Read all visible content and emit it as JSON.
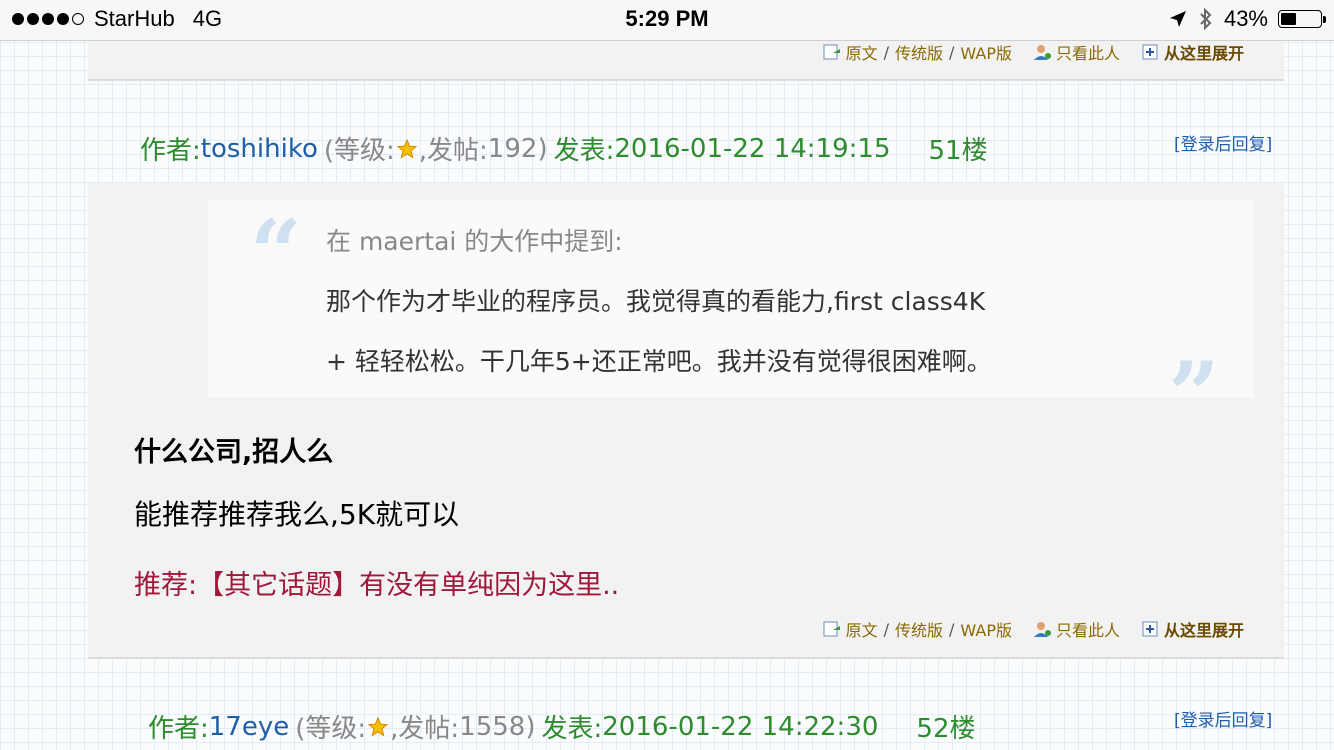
{
  "status_bar": {
    "carrier": "StarHub",
    "network": "4G",
    "time": "5:29 PM",
    "battery_percent": "43%",
    "battery_level": 0.43,
    "icons": [
      "location-arrow-icon",
      "bluetooth-icon",
      "battery-icon"
    ]
  },
  "actions": {
    "original": "原文",
    "separator": "/",
    "classic": "传统版",
    "wap": "WAP版",
    "only_author": "只看此人",
    "expand": "从这里展开"
  },
  "post51": {
    "author_label": "作者:",
    "username": "toshihiko",
    "level_open": "(等级:",
    "posts_label": ",发帖:",
    "posts_count": "192",
    "posts_close": ")",
    "published_label": "发表:",
    "timestamp": "2016-01-22 14:19:15",
    "floor": "51楼",
    "reply_link": "[登录后回复]",
    "quote": {
      "header": "在 maertai 的大作中提到:",
      "line1": "那个作为才毕业的程序员。我觉得真的看能力,first class4K",
      "line2": "+ 轻轻松松。干几年5+还正常吧。我并没有觉得很困难啊。"
    },
    "body_title": "什么公司,招人么",
    "body_text": "能推荐推荐我么,5K就可以",
    "recommend": "推荐:【其它话题】有没有单纯因为这里.."
  },
  "post52": {
    "author_label": "作者:",
    "username": "17eye",
    "level_open": "(等级:",
    "posts_label": ",发帖:",
    "posts_count": "1558",
    "posts_close": ")",
    "published_label": "发表:",
    "timestamp": "2016-01-22 14:22:30",
    "floor": "52楼",
    "reply_link": "[登录后回复]"
  },
  "colors": {
    "author_green": "#2e8b2e",
    "username_blue": "#1f5fa8",
    "recommend_red": "#a0183c",
    "action_brown": "#8a6a00"
  }
}
